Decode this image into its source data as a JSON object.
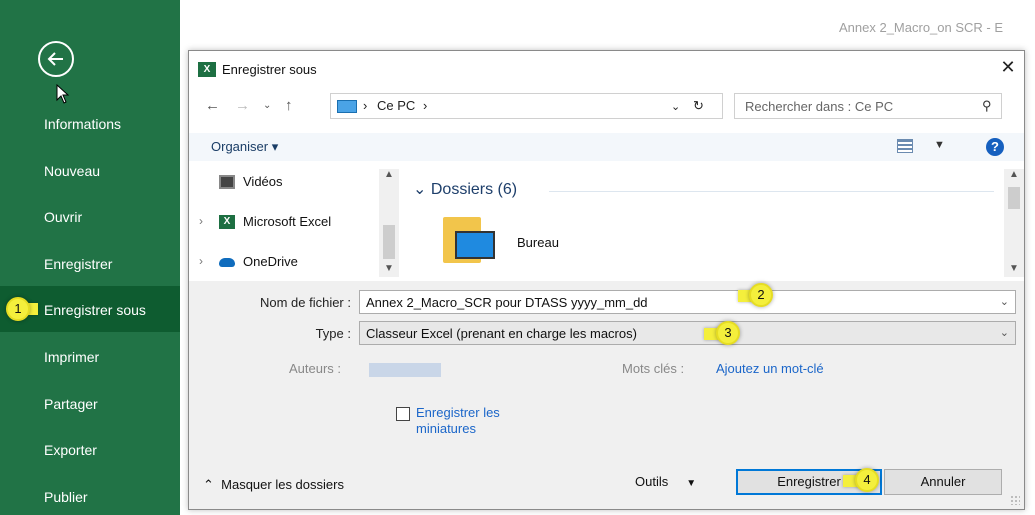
{
  "excel": {
    "window_title": "Annex 2_Macro_on SCR - E",
    "backstage_items": [
      "Informations",
      "Nouveau",
      "Ouvrir",
      "Enregistrer",
      "Enregistrer sous",
      "Imprimer",
      "Partager",
      "Exporter",
      "Publier"
    ],
    "active_item": "Enregistrer sous",
    "accent_color": "#217346"
  },
  "dialog": {
    "title": "Enregistrer sous",
    "close": "✕",
    "address": {
      "crumb_pc": "Ce PC",
      "sep": "›"
    },
    "search_placeholder": "Rechercher dans : Ce PC",
    "toolbar": {
      "organize": "Organiser ▾",
      "help": "?"
    },
    "nav_items": [
      {
        "label": "Vidéos",
        "icon": "video-icon"
      },
      {
        "label": "Microsoft Excel",
        "icon": "excel-icon"
      },
      {
        "label": "OneDrive",
        "icon": "cloud-icon"
      }
    ],
    "group_header": "Dossiers (6)",
    "folders": [
      {
        "label": "Bureau",
        "icon": "desktop-folder-icon"
      }
    ],
    "form": {
      "filename_label": "Nom de fichier :",
      "filename_value": "Annex 2_Macro_SCR pour DTASS yyyy_mm_dd",
      "type_label": "Type :",
      "type_value": "Classeur Excel (prenant en charge les macros)",
      "authors_label": "Auteurs :",
      "keywords_label": "Mots clés :",
      "keywords_link": "Ajoutez un mot-clé",
      "thumbnails_label": "Enregistrer les miniatures"
    },
    "footer": {
      "hide_folders": "Masquer les dossiers",
      "tools": "Outils",
      "save": "Enregistrer",
      "cancel": "Annuler"
    }
  },
  "annotations": [
    "1",
    "2",
    "3",
    "4"
  ],
  "annotation_color": "#f4ef3c"
}
